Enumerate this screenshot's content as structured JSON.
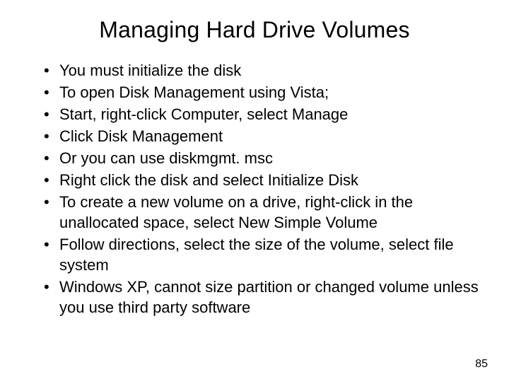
{
  "slide": {
    "title": "Managing Hard Drive Volumes",
    "bullets": [
      "You must initialize the disk",
      "To open Disk Management using Vista;",
      "Start, right-click Computer, select Manage",
      "Click Disk Management",
      "Or you can use diskmgmt. msc",
      "Right click the disk and select Initialize Disk",
      "To create a new volume on a drive, right-click in the unallocated space, select New Simple Volume",
      "Follow directions, select the size of the volume, select file system",
      "Windows XP, cannot size partition or changed volume unless you use third party software"
    ],
    "page_number": "85"
  }
}
